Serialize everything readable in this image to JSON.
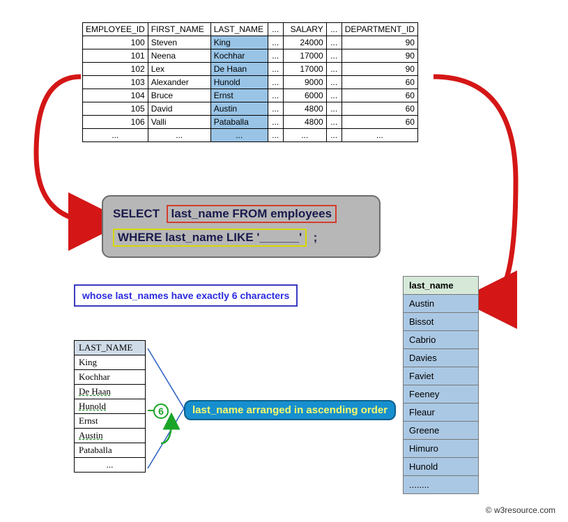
{
  "employees": {
    "headers": {
      "id": "EMPLOYEE_ID",
      "fn": "FIRST_NAME",
      "ln": "LAST_NAME",
      "gap": "...",
      "sal": "SALARY",
      "dep": "DEPARTMENT_ID"
    },
    "rows": [
      {
        "id": "100",
        "fn": "Steven",
        "ln": "King",
        "sal": "24000",
        "dep": "90"
      },
      {
        "id": "101",
        "fn": "Neena",
        "ln": "Kochhar",
        "sal": "17000",
        "dep": "90"
      },
      {
        "id": "102",
        "fn": "Lex",
        "ln": "De Haan",
        "sal": "17000",
        "dep": "90"
      },
      {
        "id": "103",
        "fn": "Alexander",
        "ln": "Hunold",
        "sal": "9000",
        "dep": "60"
      },
      {
        "id": "104",
        "fn": "Bruce",
        "ln": "Ernst",
        "sal": "6000",
        "dep": "60"
      },
      {
        "id": "105",
        "fn": "David",
        "ln": "Austin",
        "sal": "4800",
        "dep": "60"
      },
      {
        "id": "106",
        "fn": "Valli",
        "ln": "Pataballa",
        "sal": "4800",
        "dep": "60"
      }
    ],
    "ellipsis": "..."
  },
  "query": {
    "select_kw": "SELECT",
    "select_clause": "last_name FROM employees",
    "where_clause": "WHERE last_name LIKE '______'",
    "terminator": ";"
  },
  "caption1": "whose last_names have exactly 6 characters",
  "ln_list": {
    "header": "LAST_NAME",
    "rows": [
      "King",
      "Kochhar",
      "De Haan",
      "Hunold",
      "Ernst",
      "Austin",
      "Pataballa"
    ],
    "ellipsis": "..."
  },
  "six_label": "6",
  "asc_label": "last_name arranged in ascending order",
  "result": {
    "header": "last_name",
    "rows": [
      "Austin",
      "Bissot",
      "Cabrio",
      "Davies",
      "Faviet",
      "Feeney",
      "Fleaur",
      "Greene",
      "Himuro",
      "Hunold",
      "........"
    ]
  },
  "copyright": "© w3resource.com",
  "chart_data": {
    "type": "table",
    "description": "SQL diagram: SELECT last_name FROM employees WHERE last_name LIKE '______' (6 underscores = exactly 6 chars), result sorted ascending",
    "source_table_sample": [
      {
        "EMPLOYEE_ID": 100,
        "FIRST_NAME": "Steven",
        "LAST_NAME": "King",
        "SALARY": 24000,
        "DEPARTMENT_ID": 90
      },
      {
        "EMPLOYEE_ID": 101,
        "FIRST_NAME": "Neena",
        "LAST_NAME": "Kochhar",
        "SALARY": 17000,
        "DEPARTMENT_ID": 90
      },
      {
        "EMPLOYEE_ID": 102,
        "FIRST_NAME": "Lex",
        "LAST_NAME": "De Haan",
        "SALARY": 17000,
        "DEPARTMENT_ID": 90
      },
      {
        "EMPLOYEE_ID": 103,
        "FIRST_NAME": "Alexander",
        "LAST_NAME": "Hunold",
        "SALARY": 9000,
        "DEPARTMENT_ID": 60
      },
      {
        "EMPLOYEE_ID": 104,
        "FIRST_NAME": "Bruce",
        "LAST_NAME": "Ernst",
        "SALARY": 6000,
        "DEPARTMENT_ID": 60
      },
      {
        "EMPLOYEE_ID": 105,
        "FIRST_NAME": "David",
        "LAST_NAME": "Austin",
        "SALARY": 4800,
        "DEPARTMENT_ID": 60
      },
      {
        "EMPLOYEE_ID": 106,
        "FIRST_NAME": "Valli",
        "LAST_NAME": "Pataballa",
        "SALARY": 4800,
        "DEPARTMENT_ID": 60
      }
    ],
    "query": "SELECT last_name FROM employees WHERE last_name LIKE '______';",
    "filter_length": 6,
    "result_sample_ascending": [
      "Austin",
      "Bissot",
      "Cabrio",
      "Davies",
      "Faviet",
      "Feeney",
      "Fleaur",
      "Greene",
      "Himuro",
      "Hunold"
    ]
  }
}
